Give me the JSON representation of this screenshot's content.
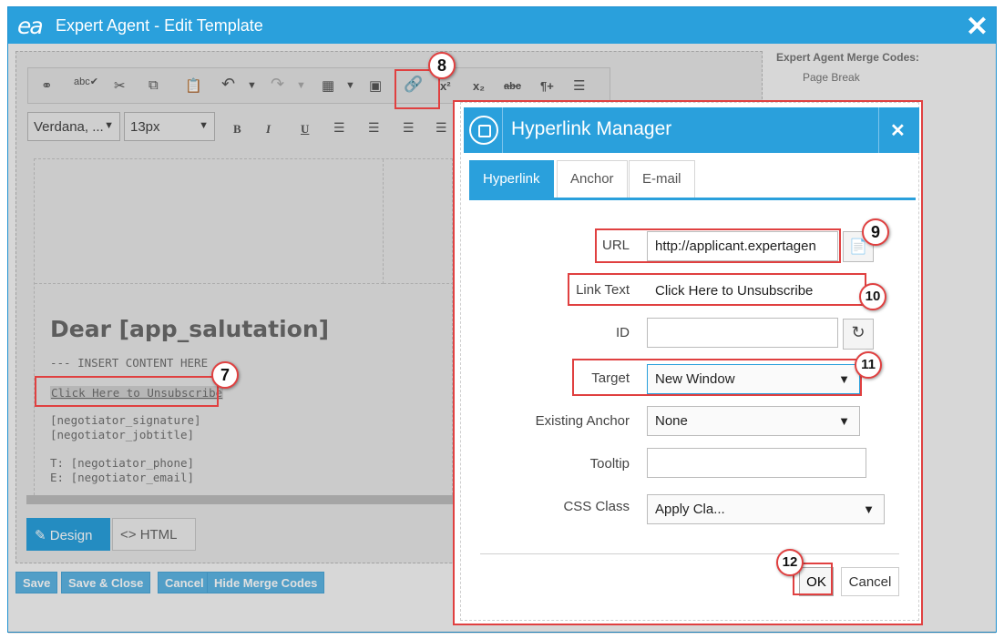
{
  "window": {
    "logo": "ea",
    "title": "Expert Agent - Edit Template",
    "close": "✕"
  },
  "toolbar": {
    "font_family": "Verdana, ...",
    "font_size": "13px",
    "bold": "B",
    "italic": "I",
    "underline": "U",
    "superscript": "x²",
    "subscript": "x₂",
    "strikethrough": "abc",
    "paragraph": "¶+"
  },
  "content": {
    "heading": "Dear [app_salutation]",
    "insert_placeholder": "--- INSERT CONTENT HERE",
    "unsubscribe_link": "Click Here to Unsubscribe",
    "signature": "[negotiator_signature]",
    "jobtitle": "[negotiator_jobtitle]",
    "phone": "T: [negotiator_phone]",
    "email": "E: [negotiator_email]"
  },
  "editor_tabs": {
    "design": "Design",
    "html": "HTML"
  },
  "bottom_buttons": {
    "save": "Save",
    "save_close": "Save & Close",
    "cancel": "Cancel",
    "hide_merge": "Hide Merge Codes"
  },
  "merge_panel": {
    "title": "Expert Agent Merge Codes:",
    "item": "Page Break"
  },
  "dialog": {
    "title": "Hyperlink Manager",
    "close": "✕",
    "tabs": [
      "Hyperlink",
      "Anchor",
      "E-mail"
    ],
    "fields": {
      "url_label": "URL",
      "url_value": "http://applicant.expertagen",
      "link_text_label": "Link Text",
      "link_text_value": "Click Here to Unsubscribe",
      "id_label": "ID",
      "id_value": "",
      "target_label": "Target",
      "target_value": "New Window",
      "existing_anchor_label": "Existing Anchor",
      "existing_anchor_value": "None",
      "tooltip_label": "Tooltip",
      "tooltip_value": "",
      "css_class_label": "CSS Class",
      "css_class_value": "Apply Cla..."
    },
    "ok": "OK",
    "cancel": "Cancel"
  },
  "annotations": [
    "7",
    "8",
    "9",
    "10",
    "11",
    "12"
  ],
  "colors": {
    "accent": "#2aa0dc",
    "annotation": "#e04040"
  }
}
